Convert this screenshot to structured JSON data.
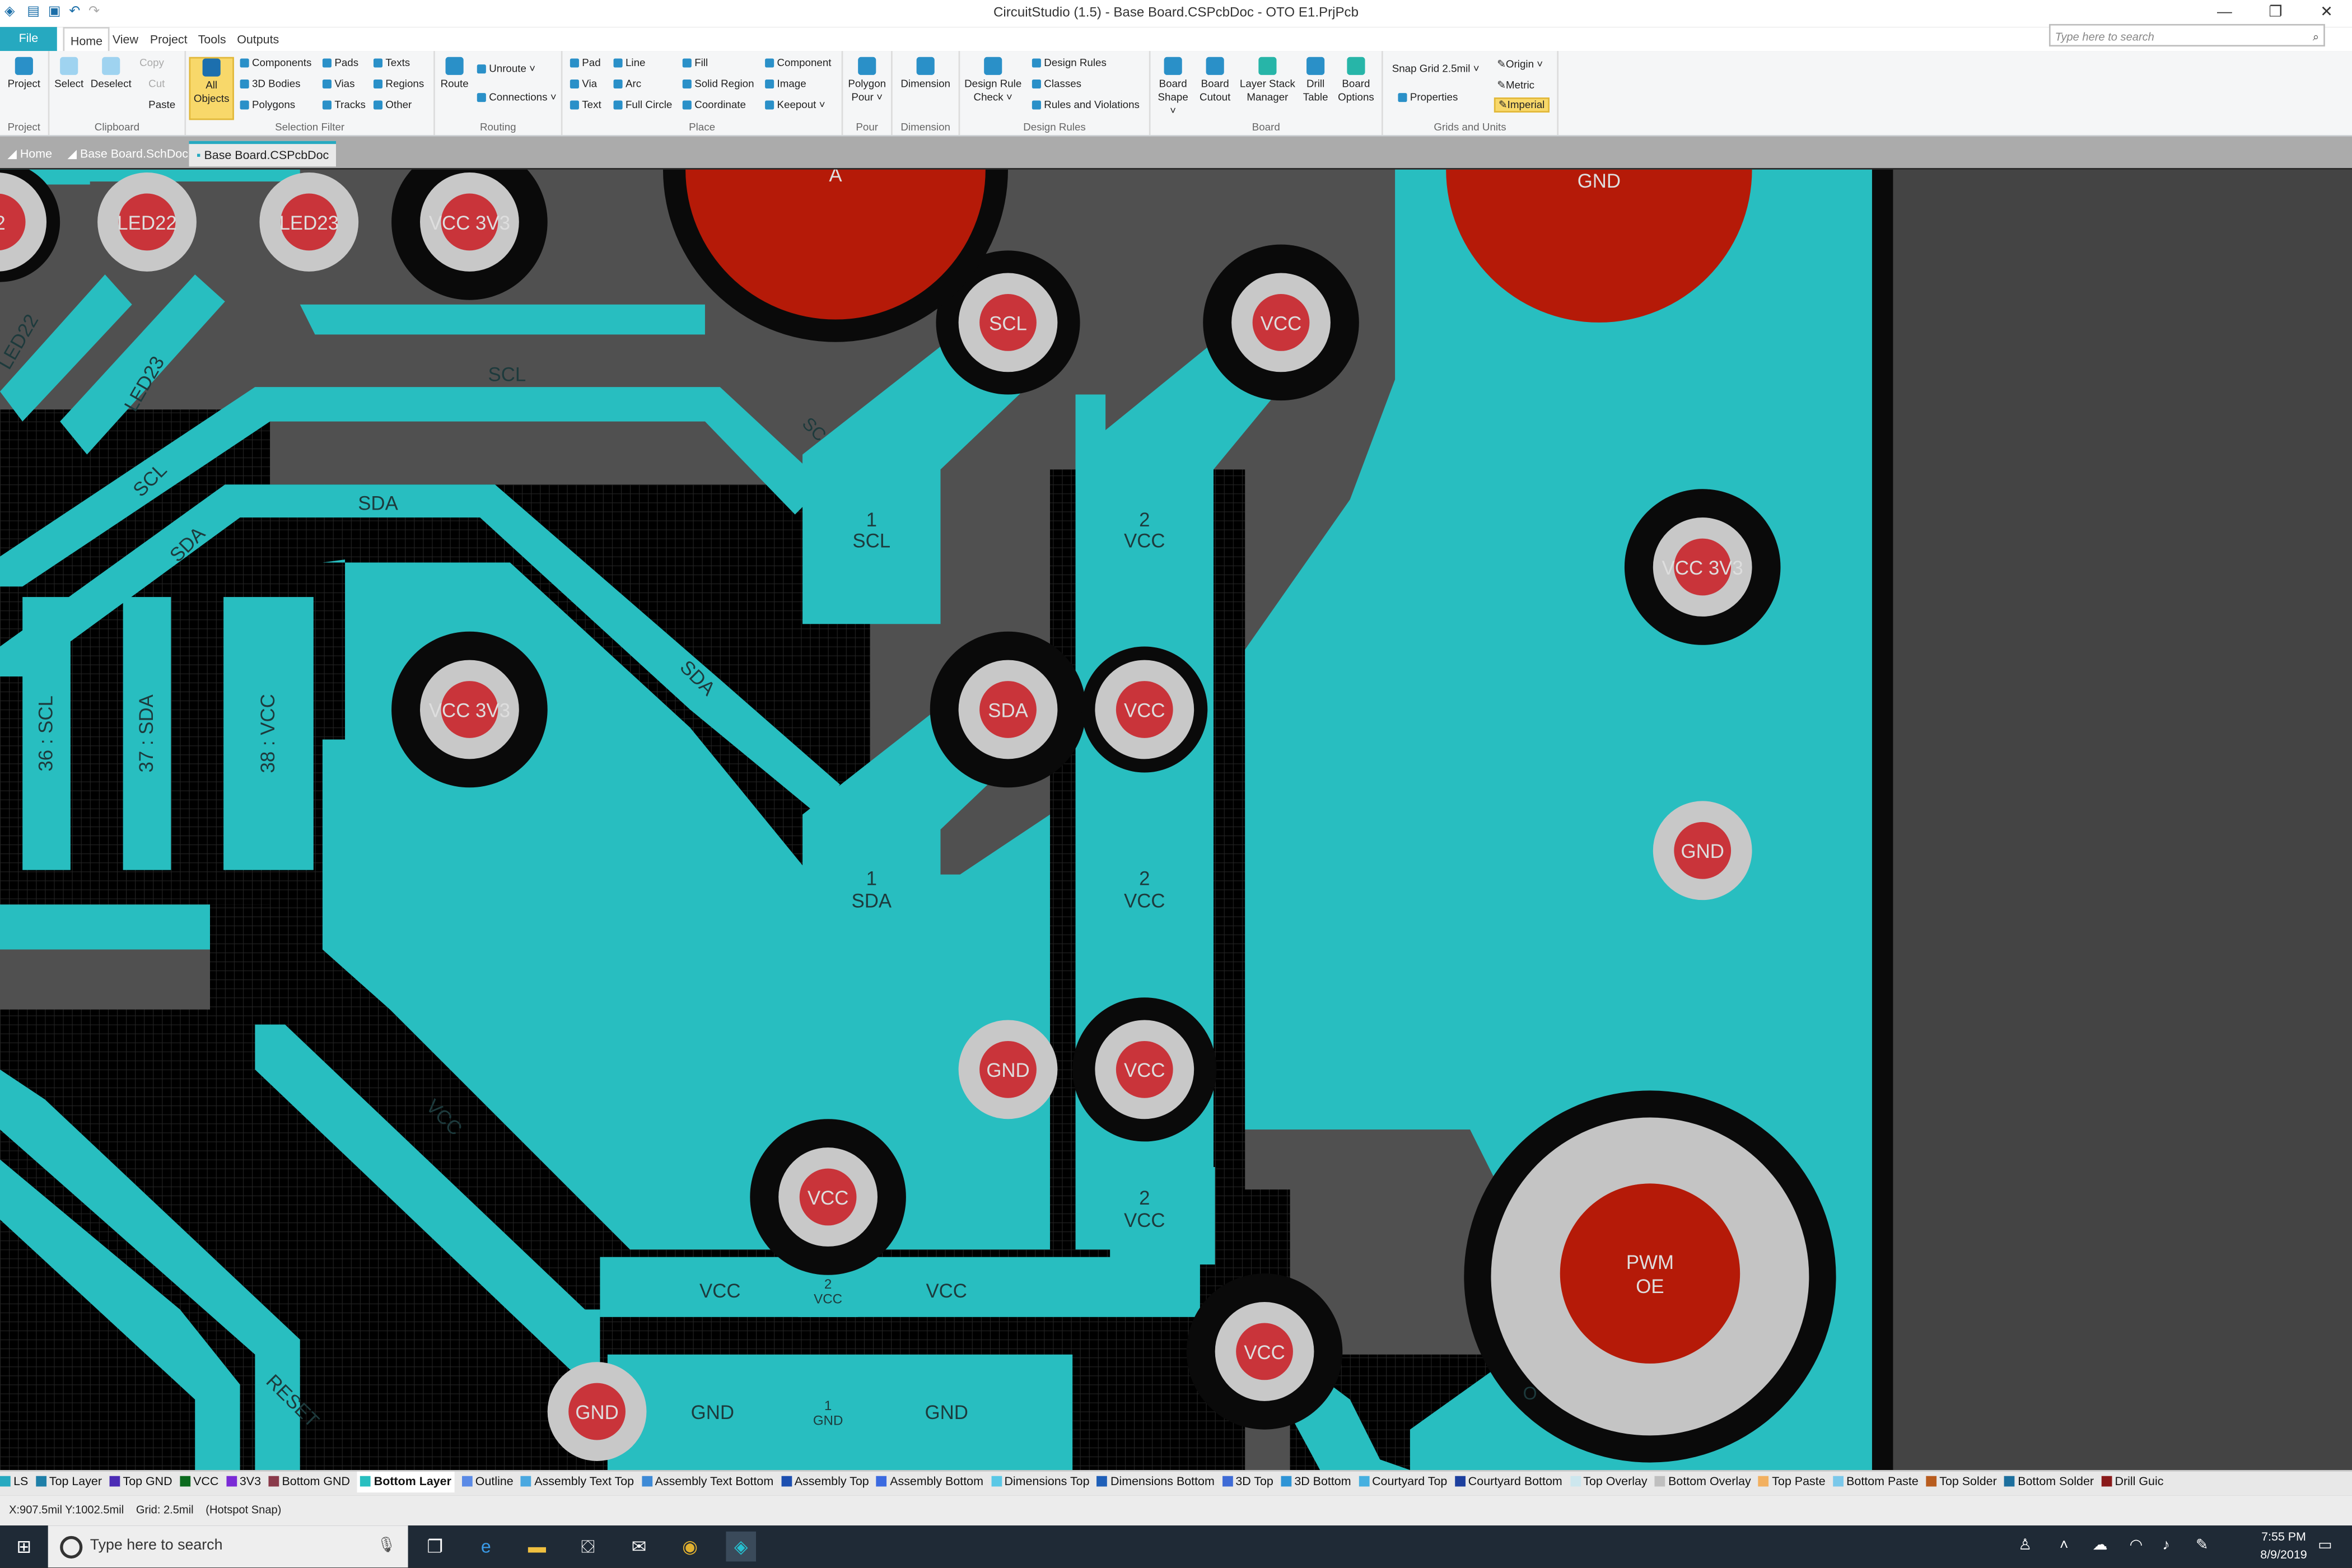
{
  "window": {
    "title": "CircuitStudio (1.5) - Base Board.CSPcbDoc - OTO E1.PrjPcb",
    "controls": [
      "—",
      "❐",
      "✕"
    ]
  },
  "menu": {
    "file": "File",
    "tabs": [
      "Home",
      "View",
      "Project",
      "Tools",
      "Outputs"
    ],
    "search_placeholder": "Type here to search"
  },
  "ribbon": {
    "groups": {
      "project": "Project",
      "clipboard": "Clipboard",
      "selection_filter": "Selection Filter",
      "routing": "Routing",
      "place": "Place",
      "pour": "Pour",
      "dimension": "Dimension",
      "design_rules": "Design Rules",
      "board": "Board",
      "grids_units": "Grids and Units"
    },
    "project_btn": "Project",
    "select_btn": "Select",
    "deselect_btn": "Deselect",
    "copy": "Copy",
    "cut": "Cut",
    "paste": "Paste",
    "all_objects_1": "All",
    "all_objects_2": "Objects",
    "filter": [
      "Components",
      "3D Bodies",
      "Polygons",
      "Pads",
      "Vias",
      "Tracks",
      "Texts",
      "Regions",
      "Other"
    ],
    "route": "Route",
    "unroute": "Unroute",
    "connections": "Connections",
    "place_items": [
      "Pad",
      "Via",
      "Text",
      "Line",
      "Arc",
      "Full Circle",
      "Fill",
      "Solid Region",
      "Coordinate",
      "Component",
      "Image",
      "Keepout"
    ],
    "polygon_pour_1": "Polygon",
    "polygon_pour_2": "Pour",
    "dimension_btn": "Dimension",
    "drc_1": "Design Rule",
    "drc_2": "Check",
    "rules": [
      "Design Rules",
      "Classes",
      "Rules and Violations"
    ],
    "board_shape_1": "Board",
    "board_shape_2": "Shape",
    "board_cutout_1": "Board",
    "board_cutout_2": "Cutout",
    "layer_stack_1": "Layer Stack",
    "layer_stack_2": "Manager",
    "drill_table_1": "Drill",
    "drill_table_2": "Table",
    "board_options_1": "Board",
    "board_options_2": "Options",
    "snap_grid": "Snap Grid",
    "snap_value": "2.5mil",
    "properties": "Properties",
    "origin": "Origin",
    "metric": "Metric",
    "imperial": "Imperial"
  },
  "doc_tabs": [
    "Home",
    "Base Board.SchDoc",
    "Base Board.CSPcbDoc"
  ],
  "pcb": {
    "pads": {
      "led22": "LED22",
      "led23": "LED23",
      "vcc3v3": "VCC 3V3",
      "scl": "SCL",
      "sda": "SDA",
      "vcc": "VCC",
      "gnd": "GND",
      "pwm_1": "PWM",
      "pwm_2": "OE",
      "a": "A",
      "partial": "2"
    },
    "labels": {
      "scl": "SCL",
      "sda": "SDA",
      "vcc": "VCC",
      "gnd": "GND",
      "reset": "RESET",
      "led22": "LED22",
      "led23": "LED23",
      "n1": "1",
      "n2": "2",
      "sc_partial": "SC",
      "o_partial": "O",
      "pin36": "36 : SCL",
      "pin37": "37 : SDA",
      "pin38": "38 : VCC"
    }
  },
  "layers": [
    {
      "name": "LS",
      "color": "#26a9c0"
    },
    {
      "name": "Top Layer",
      "color": "#1e7fa8"
    },
    {
      "name": "Top GND",
      "color": "#4b2bb5"
    },
    {
      "name": "VCC",
      "color": "#0c6b1f"
    },
    {
      "name": "3V3",
      "color": "#7a2bd6"
    },
    {
      "name": "Bottom GND",
      "color": "#8a3a4a"
    },
    {
      "name": "Bottom Layer",
      "color": "#29bfc0"
    },
    {
      "name": "Outline",
      "color": "#5a8ae6"
    },
    {
      "name": "Assembly Text Top",
      "color": "#4aa8e0"
    },
    {
      "name": "Assembly Text Bottom",
      "color": "#3d8ad6"
    },
    {
      "name": "Assembly Top",
      "color": "#1c4fb0"
    },
    {
      "name": "Assembly Bottom",
      "color": "#3b6ae0"
    },
    {
      "name": "Dimensions Top",
      "color": "#5ac8e6"
    },
    {
      "name": "Dimensions Bottom",
      "color": "#1e5fb8"
    },
    {
      "name": "3D Top",
      "color": "#3e6bd6"
    },
    {
      "name": "3D Bottom",
      "color": "#2e94d6"
    },
    {
      "name": "Courtyard Top",
      "color": "#46b0e0"
    },
    {
      "name": "Courtyard Bottom",
      "color": "#1c3f9e"
    },
    {
      "name": "Top Overlay",
      "color": "#cde7ee"
    },
    {
      "name": "Bottom Overlay",
      "color": "#bfbfbf"
    },
    {
      "name": "Top Paste",
      "color": "#f2b060"
    },
    {
      "name": "Bottom Paste",
      "color": "#7ac8ea"
    },
    {
      "name": "Top Solder",
      "color": "#b85c1e"
    },
    {
      "name": "Bottom Solder",
      "color": "#1c6f9e"
    },
    {
      "name": "Drill Guic",
      "color": "#8a1a1a"
    }
  ],
  "status": {
    "coords": "X:907.5mil Y:1002.5mil",
    "grid": "Grid: 2.5mil",
    "snap": "(Hotspot Snap)"
  },
  "taskbar": {
    "search": "Type here to search",
    "time": "7:55 PM",
    "date": "8/9/2019"
  }
}
